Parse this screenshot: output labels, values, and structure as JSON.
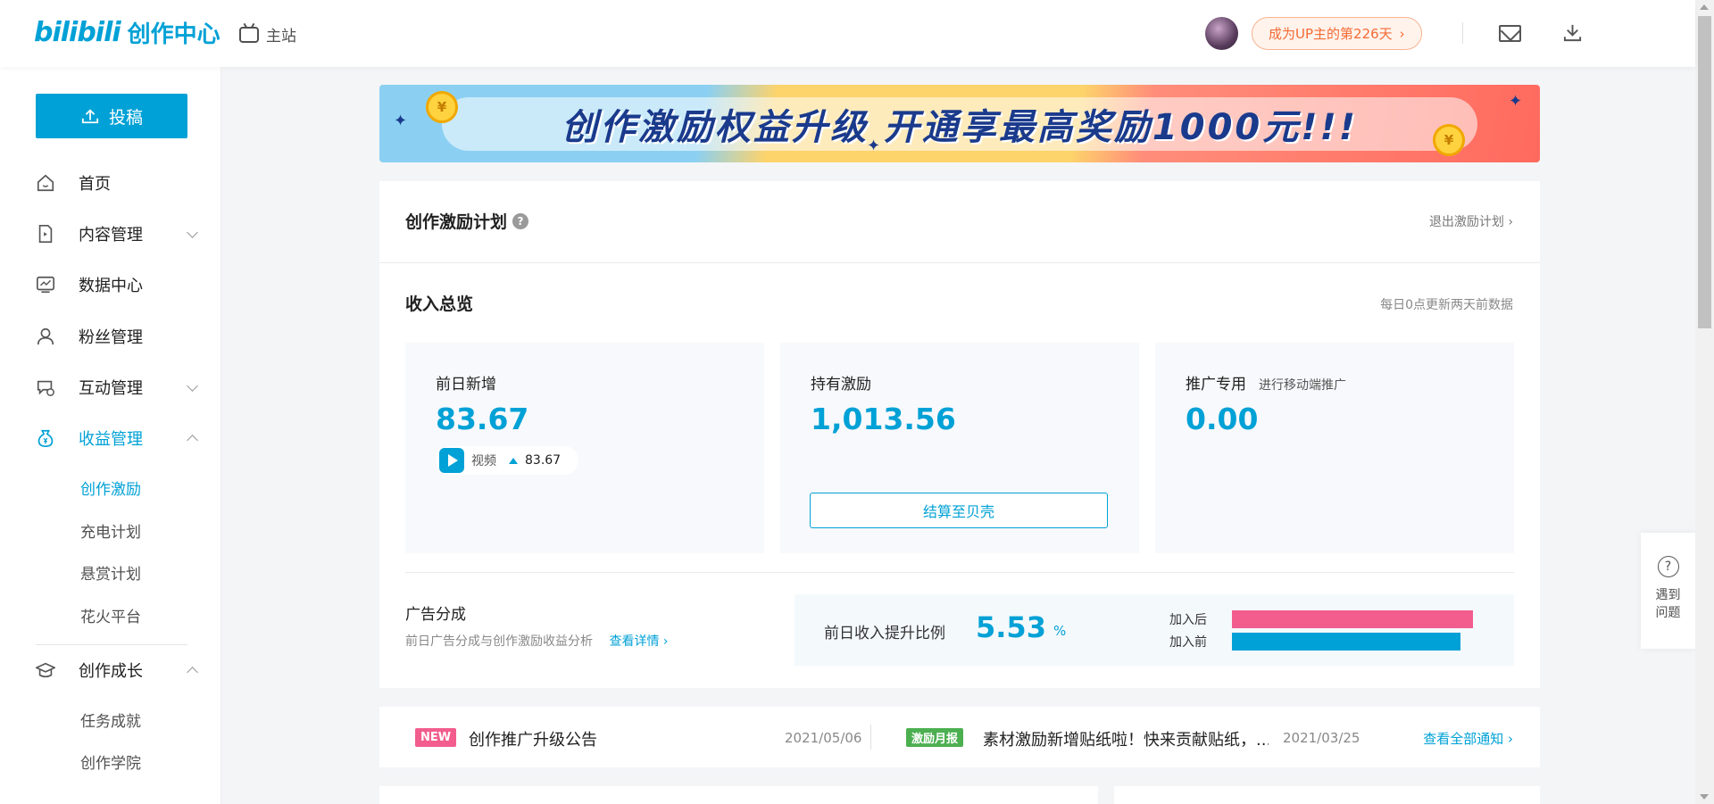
{
  "header": {
    "logo_mark": "bilibili",
    "logo_text": "创作中心",
    "main_site": "主站",
    "up_pill": "成为UP主的第226天"
  },
  "sidebar": {
    "upload": "投稿",
    "items": [
      {
        "label": "首页",
        "icon": "home-icon"
      },
      {
        "label": "内容管理",
        "icon": "content-icon"
      },
      {
        "label": "数据中心",
        "icon": "chart-icon"
      },
      {
        "label": "粉丝管理",
        "icon": "fans-icon"
      },
      {
        "label": "互动管理",
        "icon": "chat-icon"
      },
      {
        "label": "收益管理",
        "icon": "money-bag-icon"
      },
      {
        "label": "创作成长",
        "icon": "graduation-cap-icon"
      }
    ],
    "income_sub": [
      "创作激励",
      "充电计划",
      "悬赏计划",
      "花火平台"
    ],
    "growth_sub": [
      "任务成就",
      "创作学院"
    ]
  },
  "banner": {
    "text": "创作激励权益升级  开通享最高奖励1000元!!!",
    "coin_symbol": "¥"
  },
  "incentive": {
    "title": "创作激励计划",
    "help": "?",
    "exit": "退出激励计划"
  },
  "overview": {
    "title": "收入总览",
    "note": "每日0点更新两天前数据",
    "yesterday_label": "前日新增",
    "yesterday_value": "83.67",
    "video_label": "视频",
    "video_value": "83.67",
    "hold_label": "持有激励",
    "hold_value": "1,013.56",
    "settle_button": "结算至贝壳",
    "promo_label": "推广专用",
    "promo_sub": "进行移动端推广",
    "promo_value": "0.00"
  },
  "ad": {
    "title": "广告分成",
    "desc": "前日广告分成与创作激励收益分析",
    "detail_link": "查看详情",
    "ratio_label": "前日收入提升比例",
    "ratio_value": "5.53",
    "ratio_unit": "%",
    "after_label": "加入后",
    "before_label": "加入前",
    "after_color": "#f25d8e",
    "before_color": "#00a1d6",
    "after_level": 1.0,
    "before_level": 0.947
  },
  "notices": {
    "n1_badge": "NEW",
    "n1_text": "创作推广升级公告",
    "n1_date": "2021/05/06",
    "n2_badge": "激励月报",
    "n2_text": "素材激励新增贴纸啦！快来贡献贴纸，...",
    "n2_date": "2021/03/25",
    "all": "查看全部通知"
  },
  "float_help": {
    "symbol": "?",
    "label": "遇到问题"
  },
  "colors": {
    "brand": "#00a1d6",
    "new_badge": "#f25d8e",
    "report_badge": "#4caf50"
  }
}
